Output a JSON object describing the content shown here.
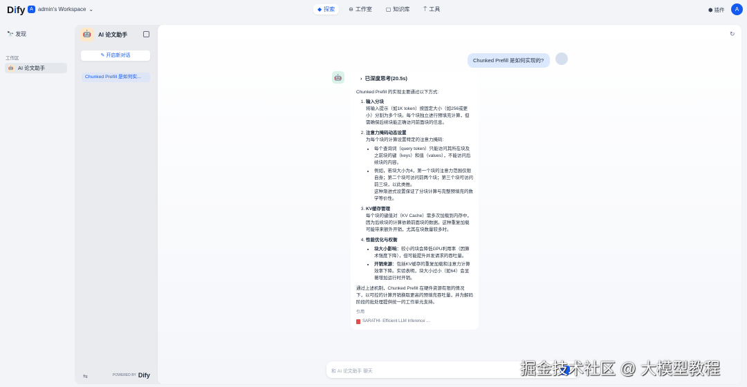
{
  "header": {
    "logo": "Dify",
    "workspace_initial": "A",
    "workspace": "admin's Workspace",
    "nav": [
      {
        "label": "探索",
        "icon": "compass-icon"
      },
      {
        "label": "工作室",
        "icon": "robot-icon"
      },
      {
        "label": "知识库",
        "icon": "book-icon"
      },
      {
        "label": "工具",
        "icon": "hammer-icon"
      }
    ],
    "plugins": "插件",
    "user_initial": "A"
  },
  "sidebar": {
    "discover": "发现",
    "workspace_label": "工作区",
    "app_item": "AI 论文助手"
  },
  "conversations": {
    "app_title": "AI 论文助手",
    "new_chat": "开启新对话",
    "items": [
      "Chunked Prefill 是如何实..."
    ],
    "powered_by": "POWERED BY",
    "powered_brand": "Dify"
  },
  "chat": {
    "user_message": "Chunked Prefill 是如何实现的?",
    "thinking": "已深度思考(20.5s)",
    "intro": "Chunked Prefill 的实现主要通过以下方式:",
    "sections": [
      {
        "title": "输入分块",
        "body": "将输入提示（如1K token）按固定大小（如256或更小）分割为多个块。每个块独立进行预填充计算，但需确保后续块能正确访问前面块的信息。"
      },
      {
        "title": "注意力掩码动态设置",
        "body": "为每个块的计算设置特定的注意力掩码:",
        "bullets": [
          "每个查询词（query token）只能访问其所在块及之前块的键（keys）和值（values），不能访问后续块的内容。",
          "例如，若块大小为4，第一个块的注意力范围仅限自身；第二个块可访问前两个块；第三个块可访问前三块，以此类推。"
        ],
        "after": "这种渐进式设置保证了分块计算与完整预填充的数学等价性。"
      },
      {
        "title": "KV缓存管理",
        "body": "每个块的键值对（KV Cache）需多次加载到内存中，因为后续块的计算依赖前面块的数据。这种重复加载可能带来额外开销，尤其在块数量较多时。"
      },
      {
        "title": "性能优化与权衡",
        "bullets_bold": [
          {
            "k": "块大小影响",
            "v": "：较小的块会降低GPU利用率（因算术强度下降），但可能提升并发请求的吞吐量。"
          },
          {
            "k": "开销来源",
            "v": "：包括KV缓存的重复加载和注意力计算效率下降。实验表明，块大小过小（如64）会显著增加运行时开销。"
          }
        ]
      }
    ],
    "conclusion": "通过上述机制，Chunked Prefill 在硬件资源有限的情况下，以可控的计算开销换取更高的预填充吞吐量，并为解码阶段的批处理提供统一的工作单元支持。",
    "citation_label": "引用",
    "citation": "SARATHI- Efficient LLM Inference ...",
    "input_placeholder": "和 AI 论文助手 聊天"
  },
  "watermark": "掘金技术社区 @ 大模型教程"
}
